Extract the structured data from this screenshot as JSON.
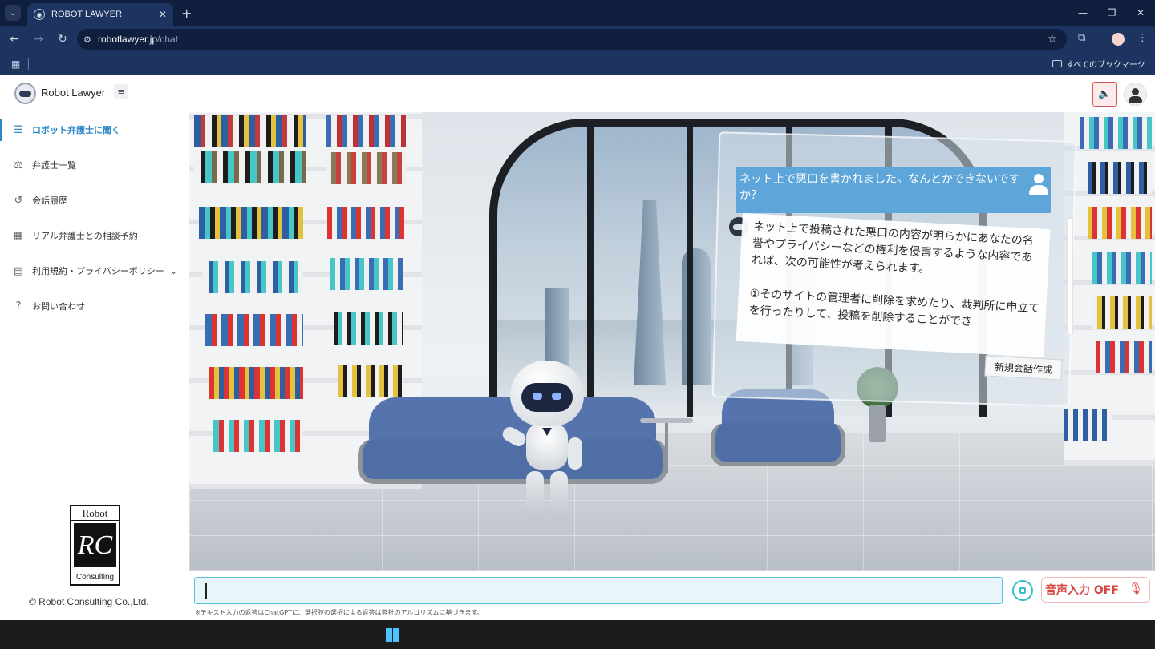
{
  "browser": {
    "tab_title": "ROBOT LAWYER",
    "url_host": "robotlawyer.jp",
    "url_path": "/chat",
    "bookmarks_all": "すべてのブックマーク"
  },
  "header": {
    "brand": "Robot Lawyer"
  },
  "sidebar": {
    "items": [
      {
        "label": "ロボット弁護士に聞く",
        "icon": "robot-chat-icon",
        "active": true
      },
      {
        "label": "弁護士一覧",
        "icon": "scales-icon"
      },
      {
        "label": "会話履歴",
        "icon": "history-icon"
      },
      {
        "label": "リアル弁護士との相談予約",
        "icon": "calendar-icon"
      },
      {
        "label": "利用規約・プライバシーポリシー",
        "icon": "document-icon",
        "has_submenu": true
      },
      {
        "label": "お問い合わせ",
        "icon": "question-icon"
      }
    ],
    "logo": {
      "top": "Robot",
      "middle": "RC",
      "bottom": "Consulting"
    },
    "copyright": "© Robot Consulting Co.,Ltd."
  },
  "chat": {
    "user_message": "ネット上で悪口を書かれました。なんとかできないですか？",
    "bot_message": "ネット上で投稿された悪口の内容が明らかにあなたの名誉やプライバシーなどの権利を侵害するような内容であれば、次の可能性が考えられます。\n\n①そのサイトの管理者に削除を求めたり、裁判所に申立てを行ったりして、投稿を削除することができ",
    "new_chat_label": "新規会話作成"
  },
  "input": {
    "value": "",
    "placeholder": "",
    "voice_label": "音声入力 OFF",
    "disclaimer": "※テキスト入力の返答はChatGPTに、選択肢の選択による返答は弊社のアルゴリズムに基づきます。"
  },
  "colors": {
    "accent": "#2e88c8",
    "user_bubble": "#5ea6d9",
    "voice_off": "#d64541",
    "input_border": "#5bc0de"
  }
}
